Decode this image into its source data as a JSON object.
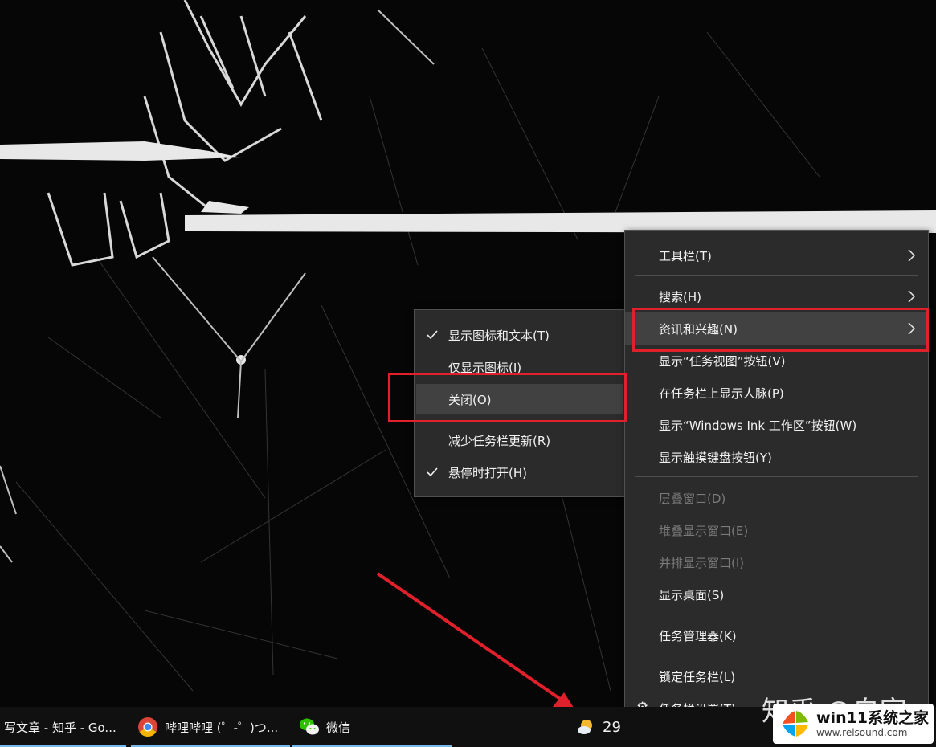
{
  "main_menu": {
    "items": [
      {
        "label": "工具栏(T)",
        "submenu": true,
        "enabled": true
      },
      {
        "label": "搜索(H)",
        "submenu": true,
        "enabled": true
      },
      {
        "label": "资讯和兴趣(N)",
        "submenu": true,
        "enabled": true,
        "highlighted": true
      },
      {
        "label": "显示“任务视图”按钮(V)",
        "enabled": true
      },
      {
        "label": "在任务栏上显示人脉(P)",
        "enabled": true
      },
      {
        "label": "显示“Windows Ink 工作区”按钮(W)",
        "enabled": true
      },
      {
        "label": "显示触摸键盘按钮(Y)",
        "enabled": true
      },
      {
        "label": "层叠窗口(D)",
        "enabled": false
      },
      {
        "label": "堆叠显示窗口(E)",
        "enabled": false
      },
      {
        "label": "并排显示窗口(I)",
        "enabled": false
      },
      {
        "label": "显示桌面(S)",
        "enabled": true
      },
      {
        "label": "任务管理器(K)",
        "enabled": true
      },
      {
        "label": "锁定任务栏(L)",
        "enabled": true
      },
      {
        "label": "任务栏设置(T)",
        "enabled": true,
        "icon": "gear-icon"
      }
    ]
  },
  "sub_menu": {
    "items": [
      {
        "label": "显示图标和文本(T)",
        "checked": true
      },
      {
        "label": "仅显示图标(I)",
        "checked": false
      },
      {
        "label": "关闭(O)",
        "checked": false,
        "highlighted": true
      },
      {
        "label": "减少任务栏更新(R)",
        "checked": false
      },
      {
        "label": "悬停时打开(H)",
        "checked": true
      }
    ]
  },
  "taskbar": {
    "apps": [
      {
        "label": "写文章 - 知乎 - Go...",
        "icon": "chrome-icon"
      },
      {
        "label": "哔哩哔哩 (゜-゜)つ...",
        "icon": "chrome-icon"
      },
      {
        "label": "微信",
        "icon": "wechat-icon"
      }
    ],
    "weather_text": "29",
    "weather_icon": "partly-cloudy-icon"
  },
  "watermark": {
    "zhihu_text": "知乎 @自宅",
    "site_title": "win11系统之家",
    "site_url": "www.relsound.com"
  },
  "colors": {
    "menu_bg": "#2b2b2b",
    "highlight": "#414141",
    "annotation_red": "#e0202a",
    "taskbar_underline": "#76b9ed"
  }
}
